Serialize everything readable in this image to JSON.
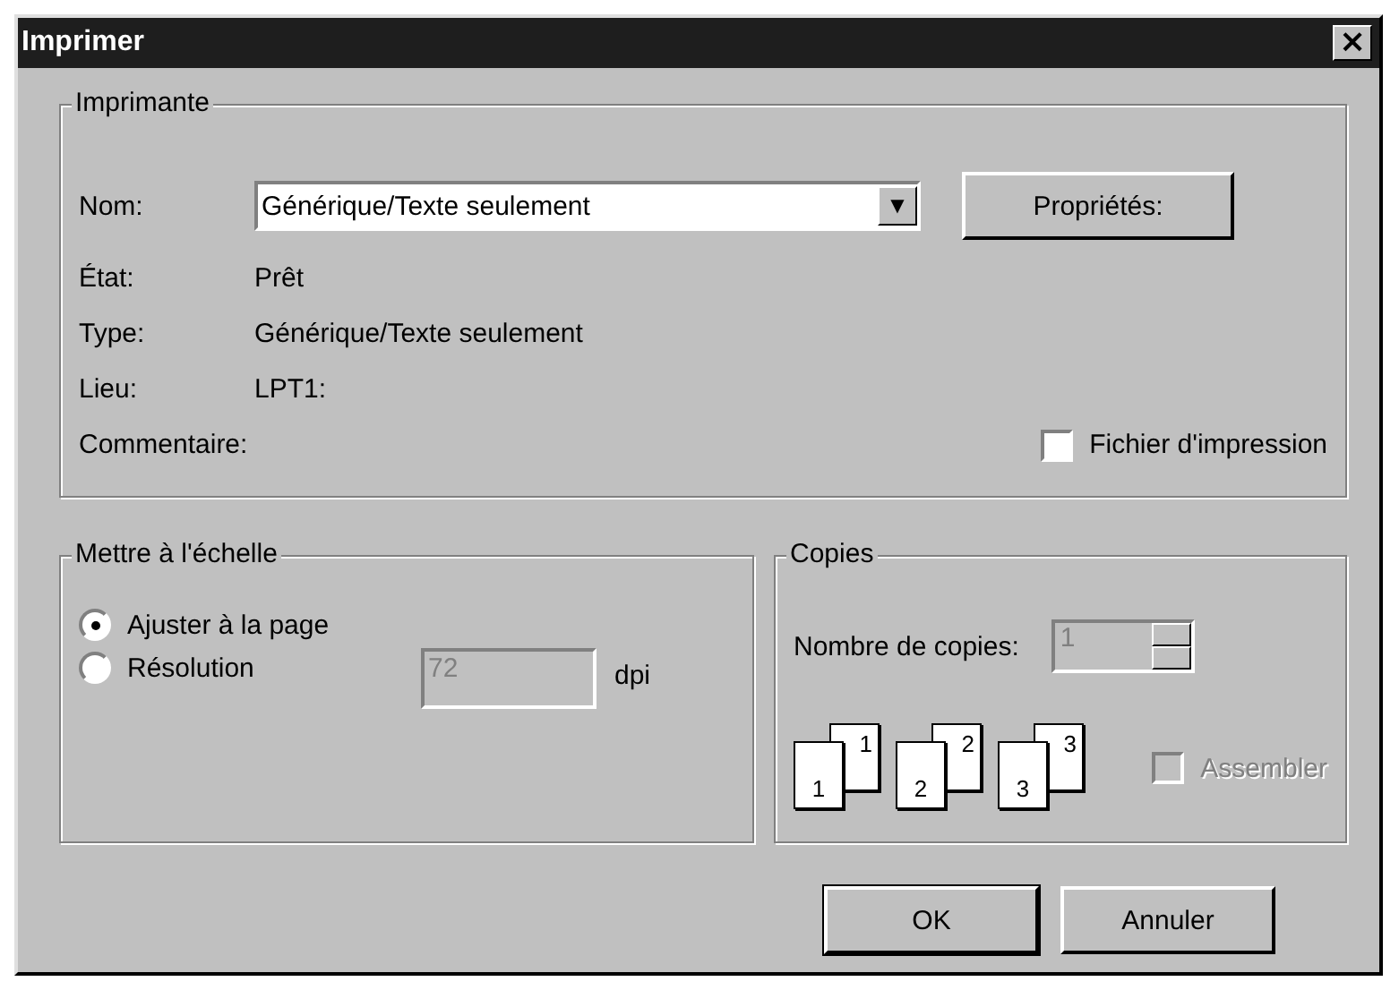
{
  "window": {
    "title": "Imprimer",
    "close": "×"
  },
  "printer": {
    "legend": "Imprimante",
    "name_label": "Nom:",
    "name_value": "Générique/Texte seulement",
    "dropdown_arrow": "▼",
    "properties_button": "Propriétés:",
    "info": [
      {
        "label": "État:",
        "value": "Prêt"
      },
      {
        "label": "Type:",
        "value": "Générique/Texte seulement"
      },
      {
        "label": "Lieu:",
        "value": "LPT1:"
      },
      {
        "label": "Commentaire:"
      }
    ],
    "print_to_file": {
      "label": "Fichier d'impression",
      "checked": false
    }
  },
  "scale": {
    "legend": "Mettre à l'échelle",
    "options": [
      {
        "label": "Ajuster à la page",
        "selected": true
      },
      {
        "label": "Résolution",
        "selected": false
      }
    ],
    "resolution_value": "72",
    "resolution_disabled": true,
    "unit": "dpi"
  },
  "copies": {
    "legend": "Copies",
    "count_label": "Nombre de copies:",
    "count_value": "1",
    "count_disabled": true,
    "collate_pages": [
      {
        "back": "1",
        "front": "1"
      },
      {
        "back": "2",
        "front": "2"
      },
      {
        "back": "3",
        "front": "3"
      }
    ],
    "collate": {
      "label": "Assembler",
      "checked": false,
      "disabled": true
    }
  },
  "buttons": [
    {
      "label": "OK",
      "default": true
    },
    {
      "label": "Annuler",
      "default": false
    }
  ]
}
